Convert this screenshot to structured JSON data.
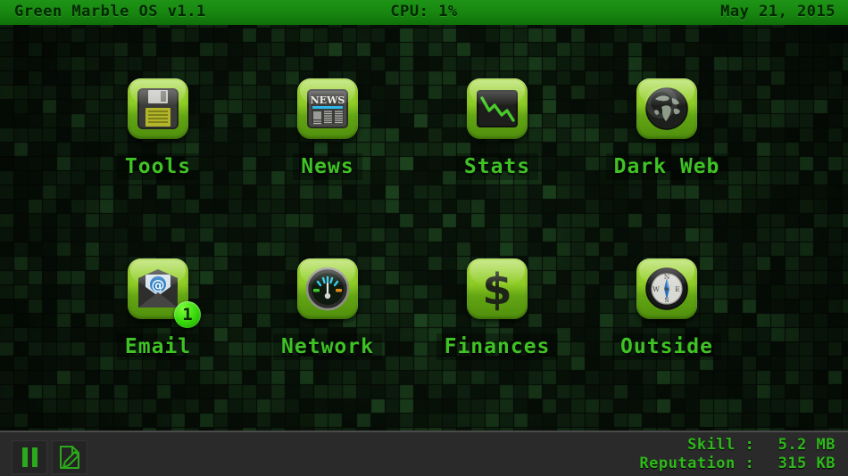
{
  "topbar": {
    "os_title": "Green Marble OS v1.1",
    "cpu": "CPU: 1%",
    "date": "May 21, 2015",
    "bar_color": "#17850f",
    "text_color": "#032803"
  },
  "desktop": {
    "icons": [
      {
        "label": "Tools",
        "icon": "floppy-disk-icon",
        "badge": ""
      },
      {
        "label": "News",
        "icon": "newspaper-icon",
        "badge": ""
      },
      {
        "label": "Stats",
        "icon": "line-chart-icon",
        "badge": ""
      },
      {
        "label": "Dark Web",
        "icon": "globe-icon",
        "badge": ""
      },
      {
        "label": "Email",
        "icon": "envelope-at-icon",
        "badge": "1"
      },
      {
        "label": "Network",
        "icon": "gauge-icon",
        "badge": ""
      },
      {
        "label": "Finances",
        "icon": "dollar-sign-icon",
        "badge": ""
      },
      {
        "label": "Outside",
        "icon": "compass-icon",
        "badge": ""
      }
    ],
    "tile_color": "#8ecb25",
    "label_color": "#3fc224",
    "badge_color": "#39d90c"
  },
  "bottombar": {
    "pause_button": "pause-icon",
    "notes_button": "note-edit-icon",
    "skill_label": "Skill :",
    "skill_value": "5.2 MB",
    "reputation_label": "Reputation :",
    "reputation_value": "315 KB",
    "text_color": "#2fb81b",
    "bar_color": "#2a2a2a"
  },
  "icon_art": {
    "news_header": "NEWS"
  }
}
